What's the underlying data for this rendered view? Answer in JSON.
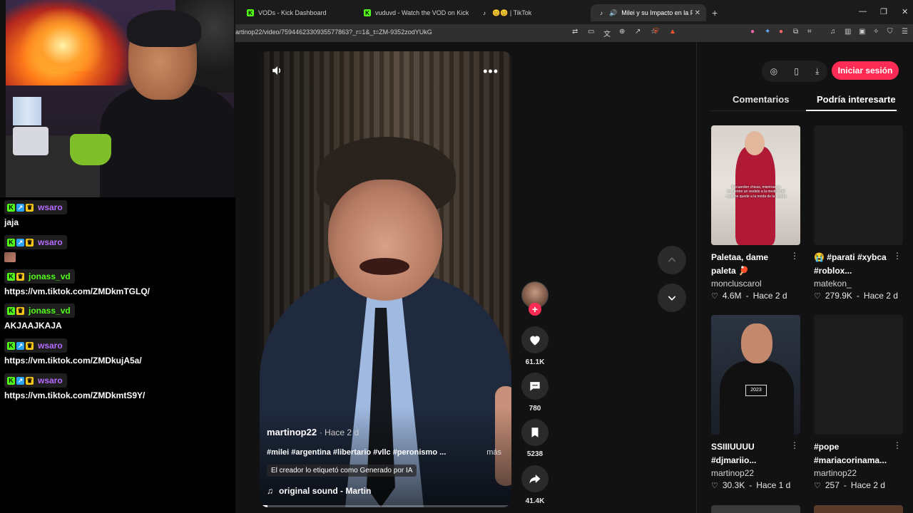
{
  "chat": {
    "messages": [
      {
        "user": "wsaro",
        "color": "purple",
        "badges": [
          "kick",
          "sub",
          "crown"
        ],
        "text": "jaja"
      },
      {
        "user": "wsaro",
        "color": "purple",
        "badges": [
          "kick",
          "sub",
          "crown"
        ],
        "text": "",
        "emote": true
      },
      {
        "user": "jonass_vd",
        "color": "green",
        "badges": [
          "kick",
          "crown"
        ],
        "text": "https://vm.tiktok.com/ZMDkmTGLQ/"
      },
      {
        "user": "jonass_vd",
        "color": "green",
        "badges": [
          "kick",
          "crown"
        ],
        "text": "AKJAAJKAJA"
      },
      {
        "user": "wsaro",
        "color": "purple",
        "badges": [
          "kick",
          "sub",
          "crown"
        ],
        "text": "https://vm.tiktok.com/ZMDkujA5a/"
      },
      {
        "user": "wsaro",
        "color": "purple",
        "badges": [
          "kick",
          "sub",
          "crown"
        ],
        "text": "https://vm.tiktok.com/ZMDkmtS9Y/"
      }
    ]
  },
  "browser": {
    "tabs": [
      {
        "label": "VODs - Kick Dashboard",
        "icon": "kick-icon"
      },
      {
        "label": "vuduvd - Watch the VOD on Kick",
        "icon": "kick-icon"
      },
      {
        "label": "😊😊 | TikTok",
        "icon": "tiktok-icon"
      },
      {
        "label": "Milei y su Impacto en la Políti",
        "icon": "tiktok-icon"
      }
    ],
    "new_tab": "+",
    "url": "artinop22/video/7594462330935577863?_r=1&_t=ZM-9352zodYUkG"
  },
  "video": {
    "author": "martinop22",
    "time": "· Hace 2 d",
    "description": "#milei #argentina #libertario #vllc #peronismo ...",
    "more": "más",
    "ai_label": "El creador lo etiquetó como Generado por IA",
    "sound": "original sound - Martin",
    "progress": 0.03
  },
  "rail": {
    "likes": "61.1K",
    "comments": "780",
    "saves": "5238",
    "shares": "41.4K"
  },
  "sidebar": {
    "login": "Iniciar sesión",
    "tabs": {
      "comments": "Comentarios",
      "suggested": "Podría interesarte"
    },
    "cards": [
      {
        "title": "Paletaa, dame paleta 🏓",
        "author": "moncluscarol",
        "views": "4.6M",
        "time": "Hace 2 d",
        "thumb_text": "Recuerden chicas, mientras yo encuentre un vestido a la medida del cual me quede a la moda de la silueta"
      },
      {
        "title": "😭 #parati #xybca #roblox...",
        "author": "matekon_",
        "views": "279.9K",
        "time": "Hace 2 d"
      },
      {
        "title": "SSIIIUUUU #djmariio...",
        "author": "martinop22",
        "views": "30.3K",
        "time": "Hace 1 d",
        "thumb_text": "2023"
      },
      {
        "title": "#pope #mariacorinama...",
        "author": "martinop22",
        "views": "257",
        "time": "Hace 2 d"
      }
    ]
  }
}
